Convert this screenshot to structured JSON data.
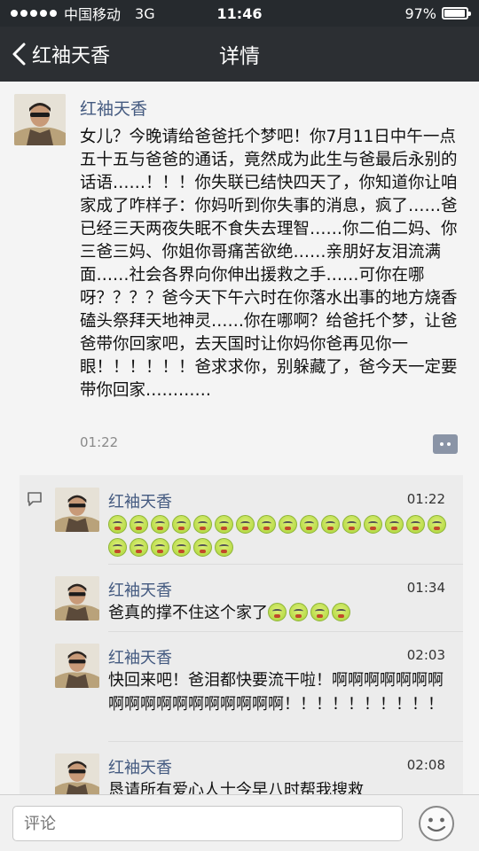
{
  "status_bar": {
    "carrier": "中国移动",
    "network": "3G",
    "time": "11:46",
    "battery": "97%",
    "battery_level": 0.97
  },
  "nav": {
    "back_label": "红袖天香",
    "title": "详情"
  },
  "post": {
    "author": "红袖天香",
    "text": "女儿？今晚请给爸爸托个梦吧！你7月11日中午一点五十五与爸爸的通话，竟然成为此生与爸最后永别的话语……！！！你失联已结快四天了，你知道你让咱家成了咋样子：你妈听到你失事的消息，疯了……爸已经三天两夜失眠不食失去理智……你二伯二妈、你三爸三妈、你姐你哥痛苦欲绝……亲朋好友泪流满面……社会各界向你伸出援救之手……可你在哪呀？？？？爸今天下午六时在你落水出事的地方烧香磕头祭拜天地神灵……你在哪啊？给爸托个梦，让爸爸带你回家吧，去天国时让你妈你爸再见你一眼！！！！！！爸求求你，别躲藏了，爸今天一定要带你回家…………",
    "time": "01:22"
  },
  "comments": [
    {
      "author": "红袖天香",
      "time": "01:22",
      "text": "",
      "emoji_count": 22
    },
    {
      "author": "红袖天香",
      "time": "01:34",
      "text": "爸真的撑不住这个家了",
      "emoji_count": 4
    },
    {
      "author": "红袖天香",
      "time": "02:03",
      "text": "快回来吧！爸泪都快要流干啦！啊啊啊啊啊啊啊啊啊啊啊啊啊啊啊啊啊啊！！！！！！！！！！",
      "emoji_count": 0
    },
    {
      "author": "红袖天香",
      "time": "02:08",
      "text": "恳请所有爱心人士今早八时帮我搜救",
      "emoji_count": 0
    }
  ],
  "input": {
    "placeholder": "评论"
  },
  "icons": {
    "back": "chevron-left-icon",
    "comment_action": "more-dots-icon",
    "comments_section": "speech-bubble-icon",
    "emoji": "angry-face-emoji-icon",
    "emoji_button": "smiley-icon"
  },
  "colors": {
    "nav_bg": "#2c2f33",
    "author_name": "#445a80",
    "page_bg": "#f4f4f4",
    "comments_bg": "#ececec"
  }
}
